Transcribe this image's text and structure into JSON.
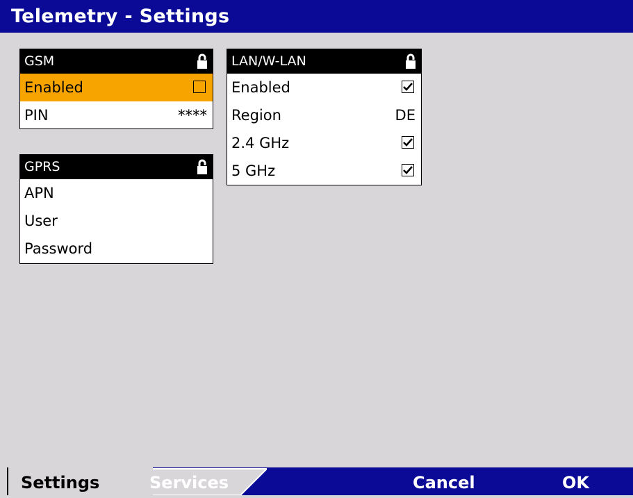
{
  "window": {
    "title": "Telemetry - Settings"
  },
  "gsm": {
    "header": "GSM",
    "lock_icon": "lock-icon",
    "rows": [
      {
        "label": "Enabled",
        "checked": false
      },
      {
        "label": "PIN",
        "value": "****"
      }
    ]
  },
  "gprs": {
    "header": "GPRS",
    "lock_icon": "lock-icon",
    "rows": [
      {
        "label": "APN"
      },
      {
        "label": "User"
      },
      {
        "label": "Password"
      }
    ]
  },
  "lan": {
    "header": "LAN/W-LAN",
    "lock_icon": "lock-icon",
    "rows": [
      {
        "label": "Enabled",
        "checked": true
      },
      {
        "label": "Region",
        "value": "DE"
      },
      {
        "label": "2.4 GHz",
        "checked": true
      },
      {
        "label": "5 GHz",
        "checked": true
      }
    ]
  },
  "bottom": {
    "tabs": [
      "Settings",
      "Services"
    ],
    "cancel": "Cancel",
    "ok": "OK"
  },
  "colors": {
    "titlebar": "#0a0a96",
    "selection": "#f8a400",
    "background": "#d9d6d9"
  }
}
